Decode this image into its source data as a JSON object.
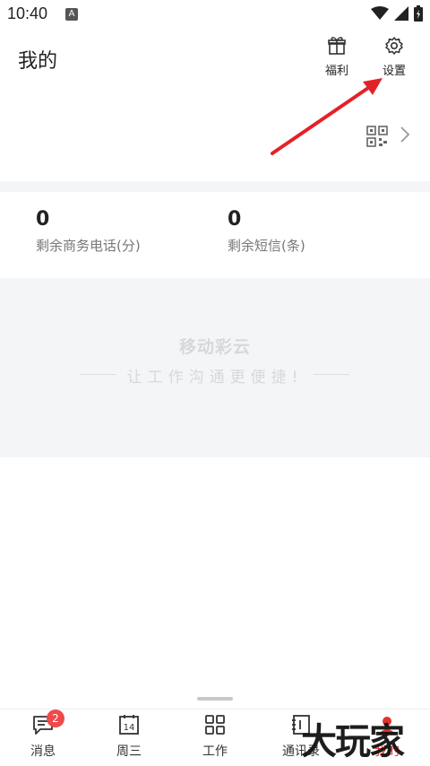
{
  "status": {
    "time": "10:40",
    "notif_icon": "A"
  },
  "header": {
    "title": "我的",
    "welfare_label": "福利",
    "settings_label": "设置"
  },
  "stats": [
    {
      "value": "0",
      "label": "剩余商务电话(分)"
    },
    {
      "value": "0",
      "label": "剩余短信(条)"
    }
  ],
  "promo": {
    "title": "移动彩云",
    "subtitle": "让工作沟通更便捷!"
  },
  "tabs": [
    {
      "label": "消息",
      "badge": "2"
    },
    {
      "label": "周三",
      "day": "14"
    },
    {
      "label": "工作"
    },
    {
      "label": "通讯录"
    },
    {
      "label": "我的"
    }
  ],
  "watermark": "大玩家",
  "colors": {
    "accent": "#e5322d",
    "arrow": "#e32228",
    "badge": "#f04a4a",
    "promo_bg": "#f4f5f7"
  }
}
